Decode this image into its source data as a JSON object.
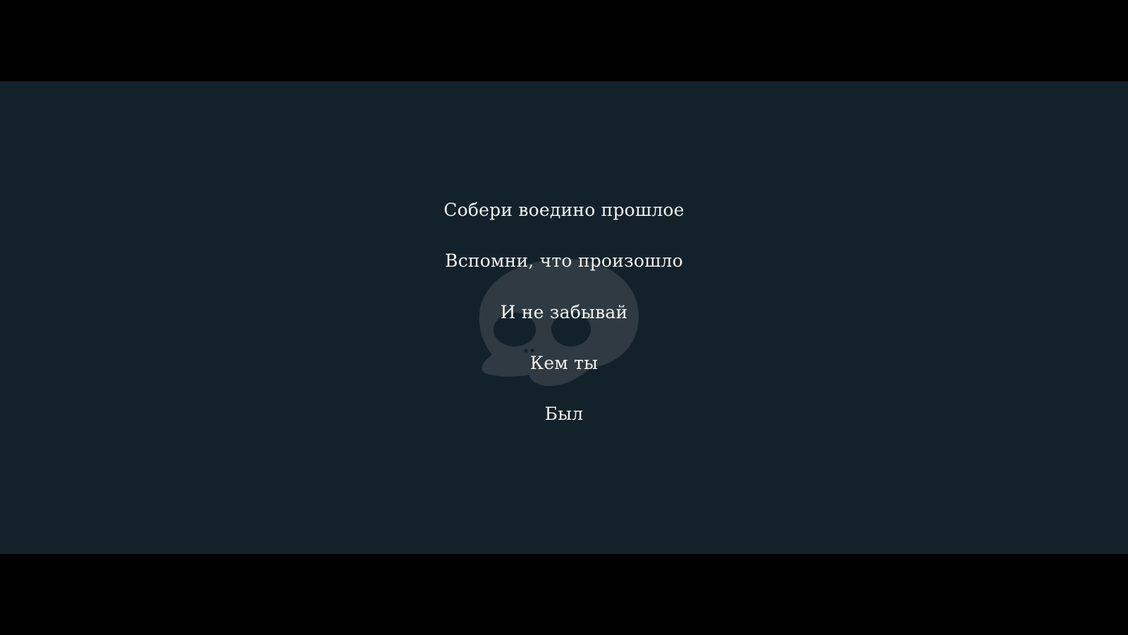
{
  "colors": {
    "letterbox": "#000000",
    "background": "#13212b",
    "text": "#f2f2ee",
    "skull": "#2f3a43"
  },
  "icons": {
    "watermark": "skull-icon"
  },
  "intro": {
    "lines": [
      "Собери воедино прошлое",
      "Вспомни, что произошло",
      "И не забывай",
      "Кем ты",
      "Был"
    ]
  }
}
